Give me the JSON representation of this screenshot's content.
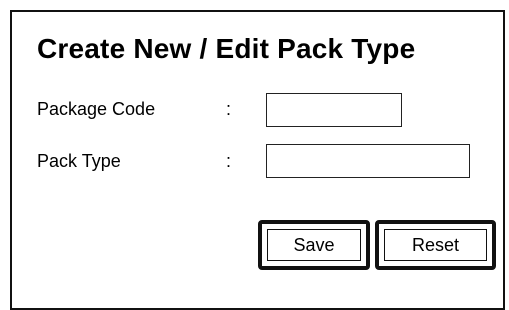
{
  "form": {
    "title": "Create New / Edit Pack Type",
    "fields": [
      {
        "label": "Package Code",
        "separator": ":",
        "value": "",
        "placeholder": ""
      },
      {
        "label": "Pack Type",
        "separator": ":",
        "value": "",
        "placeholder": ""
      }
    ],
    "buttons": {
      "save_label": "Save",
      "reset_label": "Reset"
    }
  }
}
